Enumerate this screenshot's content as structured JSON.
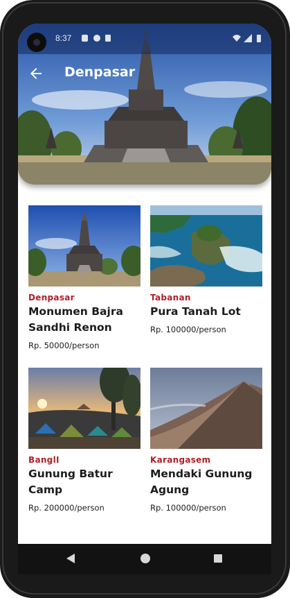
{
  "status_bar": {
    "time": "8:37"
  },
  "header": {
    "title": "Denpasar",
    "back_icon": "arrow-left-icon"
  },
  "destinations": [
    {
      "region": "Denpasar",
      "name": "Monumen Bajra Sandhi Renon",
      "price": "Rp. 50000/person",
      "image": "monument-photo"
    },
    {
      "region": "Tabanan",
      "name": "Pura Tanah Lot",
      "price": "Rp. 100000/person",
      "image": "sea-temple-photo"
    },
    {
      "region": "BanglI",
      "name": "Gunung Batur Camp",
      "price": "Rp. 200000/person",
      "image": "camping-sunset-photo"
    },
    {
      "region": "Karangasem",
      "name": "Mendaki Gunung Agung",
      "price": "Rp. 100000/person",
      "image": "mountain-ridge-photo"
    }
  ],
  "colors": {
    "region_text": "#b01e28",
    "nav_bar": "#121212",
    "device_frame": "#1a1a1a"
  }
}
